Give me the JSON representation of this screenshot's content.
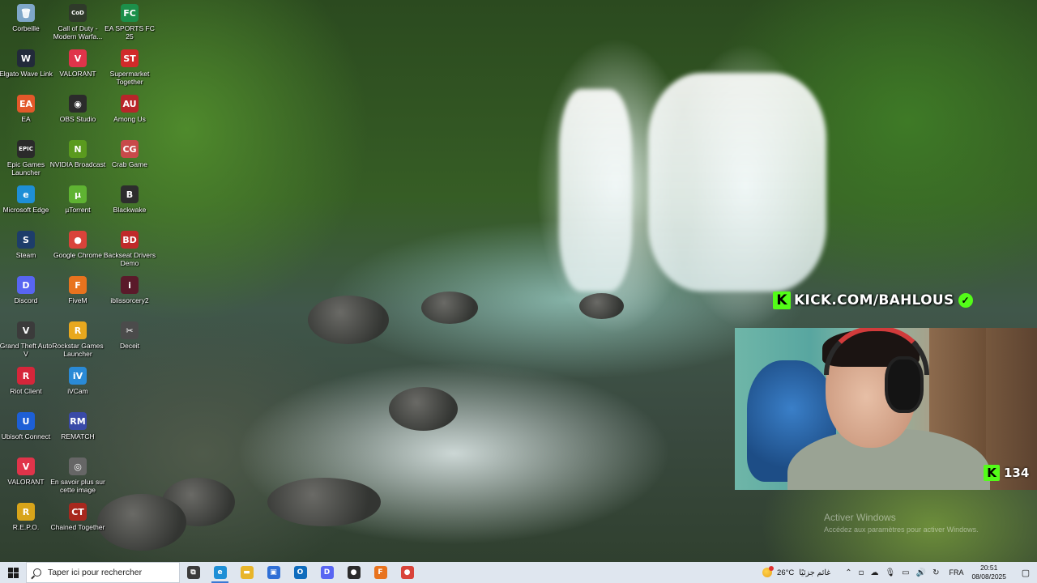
{
  "desktop_icons": [
    {
      "label": "Corbeille",
      "icon": "recycle-bin-icon",
      "color": "#7fa7c9",
      "glyph": "🗑"
    },
    {
      "label": "Call of Duty - Modern Warfa...",
      "icon": "call-of-duty-icon",
      "color": "#2f3a2a",
      "glyph": "CoD"
    },
    {
      "label": "EA SPORTS FC 25",
      "icon": "ea-sports-fc-icon",
      "color": "#1c8f4a",
      "glyph": "FC"
    },
    {
      "label": "Elgato Wave Link",
      "icon": "elgato-wave-link-icon",
      "color": "#222a3a",
      "glyph": "W"
    },
    {
      "label": "VALORANT",
      "icon": "valorant-icon",
      "color": "#e0344a",
      "glyph": "V"
    },
    {
      "label": "Supermarket Together",
      "icon": "supermarket-together-icon",
      "color": "#d12a2a",
      "glyph": "ST"
    },
    {
      "label": "EA",
      "icon": "ea-icon",
      "color": "#e3582a",
      "glyph": "EA"
    },
    {
      "label": "OBS Studio",
      "icon": "obs-studio-icon",
      "color": "#2b2b2b",
      "glyph": "◉"
    },
    {
      "label": "Among Us",
      "icon": "among-us-icon",
      "color": "#b8252a",
      "glyph": "AU"
    },
    {
      "label": "Epic Games Launcher",
      "icon": "epic-games-icon",
      "color": "#2a2a2a",
      "glyph": "EPIC"
    },
    {
      "label": "NVIDIA Broadcast",
      "icon": "nvidia-broadcast-icon",
      "color": "#5a9a1e",
      "glyph": "N"
    },
    {
      "label": "Crab Game",
      "icon": "crab-game-icon",
      "color": "#c84a4a",
      "glyph": "CG"
    },
    {
      "label": "Microsoft Edge",
      "icon": "microsoft-edge-icon",
      "color": "#1e8fd6",
      "glyph": "e"
    },
    {
      "label": "µTorrent",
      "icon": "utorrent-icon",
      "color": "#5fb332",
      "glyph": "µ"
    },
    {
      "label": "Blackwake",
      "icon": "blackwake-icon",
      "color": "#2d2d2d",
      "glyph": "B"
    },
    {
      "label": "Steam",
      "icon": "steam-icon",
      "color": "#1d3d6a",
      "glyph": "S"
    },
    {
      "label": "Google Chrome",
      "icon": "google-chrome-icon",
      "color": "#d9433a",
      "glyph": "●"
    },
    {
      "label": "Backseat Drivers Demo",
      "icon": "backseat-drivers-icon",
      "color": "#c02a2a",
      "glyph": "BD"
    },
    {
      "label": "Discord",
      "icon": "discord-icon",
      "color": "#5865f2",
      "glyph": "D"
    },
    {
      "label": "FiveM",
      "icon": "fivem-icon",
      "color": "#e8731e",
      "glyph": "F"
    },
    {
      "label": "iblissorcery2",
      "icon": "iblissorcery-icon",
      "color": "#5a1a2a",
      "glyph": "i"
    },
    {
      "label": "Grand Theft Auto V",
      "icon": "gta-v-icon",
      "color": "#3b3b3b",
      "glyph": "V"
    },
    {
      "label": "Rockstar Games Launcher",
      "icon": "rockstar-icon",
      "color": "#e8a81e",
      "glyph": "R"
    },
    {
      "label": "Deceit",
      "icon": "deceit-icon",
      "color": "#4b4b4b",
      "glyph": "✂"
    },
    {
      "label": "Riot Client",
      "icon": "riot-client-icon",
      "color": "#d6263a",
      "glyph": "R"
    },
    {
      "label": "iVCam",
      "icon": "ivcam-icon",
      "color": "#2a8ad6",
      "glyph": "iV"
    },
    {
      "label": "",
      "icon": "empty-slot",
      "color": "",
      "glyph": ""
    },
    {
      "label": "Ubisoft Connect",
      "icon": "ubisoft-connect-icon",
      "color": "#1d5fd6",
      "glyph": "U"
    },
    {
      "label": "REMATCH",
      "icon": "rematch-icon",
      "color": "#3a4aa8",
      "glyph": "RM"
    },
    {
      "label": "",
      "icon": "empty-slot",
      "color": "",
      "glyph": ""
    },
    {
      "label": "VALORANT",
      "icon": "valorant-shortcut-icon",
      "color": "#e0344a",
      "glyph": "V"
    },
    {
      "label": "En savoir plus sur cette image",
      "icon": "camera-info-icon",
      "color": "#666666",
      "glyph": "◎"
    },
    {
      "label": "",
      "icon": "empty-slot",
      "color": "",
      "glyph": ""
    },
    {
      "label": "R.E.P.O.",
      "icon": "repo-icon",
      "color": "#d8a41a",
      "glyph": "R"
    },
    {
      "label": "Chained Together",
      "icon": "chained-together-icon",
      "color": "#a8281e",
      "glyph": "CT"
    }
  ],
  "overlay": {
    "kick_letter": "K",
    "channel": "KICK.COM/BAHLOUS",
    "verified_glyph": "✓",
    "viewer_count": "134",
    "accent": "#53fc18"
  },
  "activation": {
    "title": "Activer Windows",
    "subtitle": "Accédez aux paramètres pour activer Windows."
  },
  "taskbar": {
    "search_placeholder": "Taper ici pour rechercher",
    "apps": [
      {
        "name": "task-view",
        "glyph": "⧉",
        "color": "#3b3b3b"
      },
      {
        "name": "edge",
        "glyph": "e",
        "color": "#1e8fd6",
        "active": true
      },
      {
        "name": "file-explorer",
        "glyph": "▬",
        "color": "#e8b52a"
      },
      {
        "name": "microsoft-store",
        "glyph": "▣",
        "color": "#2f6fd6"
      },
      {
        "name": "outlook",
        "glyph": "O",
        "color": "#0f6cbd"
      },
      {
        "name": "discord",
        "glyph": "D",
        "color": "#5865f2"
      },
      {
        "name": "app-dark",
        "glyph": "●",
        "color": "#2b2b2b"
      },
      {
        "name": "fivem",
        "glyph": "F",
        "color": "#e8731e"
      },
      {
        "name": "chrome",
        "glyph": "●",
        "color": "#d9433a"
      }
    ],
    "weather_temp": "26°C",
    "weather_desc": "غائم جزئيًا",
    "language": "FRA",
    "time": "20:51",
    "date": "08/08/2025"
  }
}
